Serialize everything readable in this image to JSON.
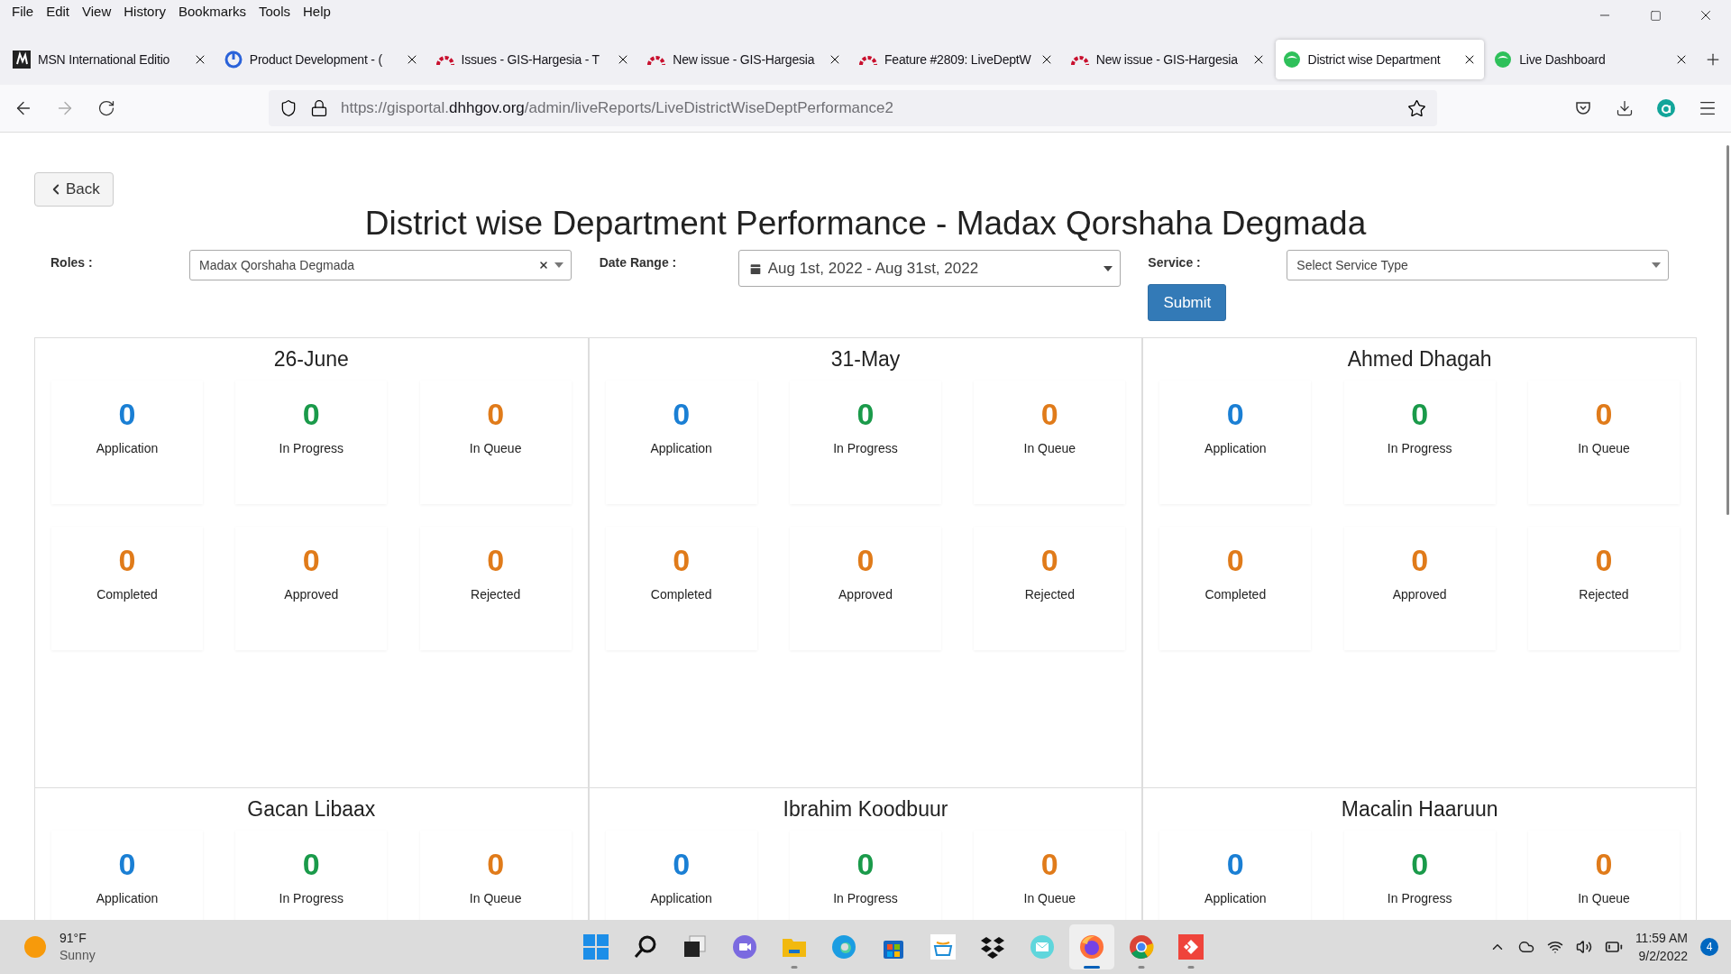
{
  "menu": [
    "File",
    "Edit",
    "View",
    "History",
    "Bookmarks",
    "Tools",
    "Help"
  ],
  "tabs": [
    {
      "label": "MSN International Editio",
      "kind": "news",
      "selected": false
    },
    {
      "label": "Product Development - (",
      "kind": "product",
      "selected": false
    },
    {
      "label": "Issues - GIS-Hargesia - T",
      "kind": "tracker",
      "selected": false
    },
    {
      "label": "New issue - GIS-Hargesia",
      "kind": "tracker",
      "selected": false
    },
    {
      "label": "Feature #2809: LiveDeptW",
      "kind": "tracker",
      "selected": false
    },
    {
      "label": "New issue - GIS-Hargesia",
      "kind": "tracker",
      "selected": false
    },
    {
      "label": "District wise Department",
      "kind": "dashboard",
      "selected": true
    },
    {
      "label": "Live Dashboard",
      "kind": "dashboard",
      "selected": false
    }
  ],
  "address": {
    "prefix": "https://gisportal.",
    "domain": "dhhgov.org",
    "path": "/admin/liveReports/LiveDistrictWiseDeptPerformance2"
  },
  "page": {
    "back": "Back",
    "title": "District wise Department Performance - Madax Qorshaha Degmada",
    "filters": [
      {
        "label": "Roles :",
        "kind": "select",
        "value": "Madax Qorshaha Degmada",
        "clearable": true
      },
      {
        "label": "Date Range :",
        "kind": "date",
        "value": "Aug 1st, 2022 - Aug 31st, 2022"
      },
      {
        "label": "Service :",
        "kind": "select",
        "placeholder": "Select Service Type",
        "clearable": false
      }
    ],
    "submit": "Submit",
    "districts": [
      {
        "name": "26-June",
        "stats": [
          {
            "value": "0",
            "label": "Application",
            "color": "#1a7fd4"
          },
          {
            "value": "0",
            "label": "In Progress",
            "color": "#1a9a4a"
          },
          {
            "value": "0",
            "label": "In Queue",
            "color": "#e07b1a"
          },
          {
            "value": "0",
            "label": "Completed",
            "color": "#e07b1a"
          },
          {
            "value": "0",
            "label": "Approved",
            "color": "#e07b1a"
          },
          {
            "value": "0",
            "label": "Rejected",
            "color": "#e07b1a"
          }
        ]
      },
      {
        "name": "31-May",
        "stats": [
          {
            "value": "0",
            "label": "Application",
            "color": "#1a7fd4"
          },
          {
            "value": "0",
            "label": "In Progress",
            "color": "#1a9a4a"
          },
          {
            "value": "0",
            "label": "In Queue",
            "color": "#e07b1a"
          },
          {
            "value": "0",
            "label": "Completed",
            "color": "#e07b1a"
          },
          {
            "value": "0",
            "label": "Approved",
            "color": "#e07b1a"
          },
          {
            "value": "0",
            "label": "Rejected",
            "color": "#e07b1a"
          }
        ]
      },
      {
        "name": "Ahmed Dhagah",
        "stats": [
          {
            "value": "0",
            "label": "Application",
            "color": "#1a7fd4"
          },
          {
            "value": "0",
            "label": "In Progress",
            "color": "#1a9a4a"
          },
          {
            "value": "0",
            "label": "In Queue",
            "color": "#e07b1a"
          },
          {
            "value": "0",
            "label": "Completed",
            "color": "#e07b1a"
          },
          {
            "value": "0",
            "label": "Approved",
            "color": "#e07b1a"
          },
          {
            "value": "0",
            "label": "Rejected",
            "color": "#e07b1a"
          }
        ]
      },
      {
        "name": "Gacan Libaax",
        "stats": [
          {
            "value": "0",
            "label": "Application",
            "color": "#1a7fd4"
          },
          {
            "value": "0",
            "label": "In Progress",
            "color": "#1a9a4a"
          },
          {
            "value": "0",
            "label": "In Queue",
            "color": "#e07b1a"
          }
        ]
      },
      {
        "name": "Ibrahim Koodbuur",
        "stats": [
          {
            "value": "0",
            "label": "Application",
            "color": "#1a7fd4"
          },
          {
            "value": "0",
            "label": "In Progress",
            "color": "#1a9a4a"
          },
          {
            "value": "0",
            "label": "In Queue",
            "color": "#e07b1a"
          }
        ]
      },
      {
        "name": "Macalin Haaruun",
        "stats": [
          {
            "value": "0",
            "label": "Application",
            "color": "#1a7fd4"
          },
          {
            "value": "0",
            "label": "In Progress",
            "color": "#1a9a4a"
          },
          {
            "value": "0",
            "label": "In Queue",
            "color": "#e07b1a"
          }
        ]
      }
    ]
  },
  "taskbar": {
    "temperature": "91°F",
    "weather": "Sunny",
    "apps": [
      {
        "kind": "start",
        "running": false,
        "selected": false
      },
      {
        "kind": "search",
        "running": false,
        "selected": false
      },
      {
        "kind": "taskview",
        "running": false,
        "selected": false
      },
      {
        "kind": "chat",
        "running": false,
        "selected": false
      },
      {
        "kind": "files",
        "running": true,
        "selected": false
      },
      {
        "kind": "edge",
        "running": false,
        "selected": false
      },
      {
        "kind": "store",
        "running": false,
        "selected": false
      },
      {
        "kind": "shop",
        "running": false,
        "selected": false
      },
      {
        "kind": "dropbox",
        "running": false,
        "selected": false
      },
      {
        "kind": "mail",
        "running": false,
        "selected": false
      },
      {
        "kind": "firefox",
        "running": true,
        "selected": true
      },
      {
        "kind": "chrome",
        "running": true,
        "selected": false
      },
      {
        "kind": "remote",
        "running": true,
        "selected": false
      }
    ],
    "time": "11:59 AM",
    "date": "9/2/2022",
    "notifications": "4"
  }
}
